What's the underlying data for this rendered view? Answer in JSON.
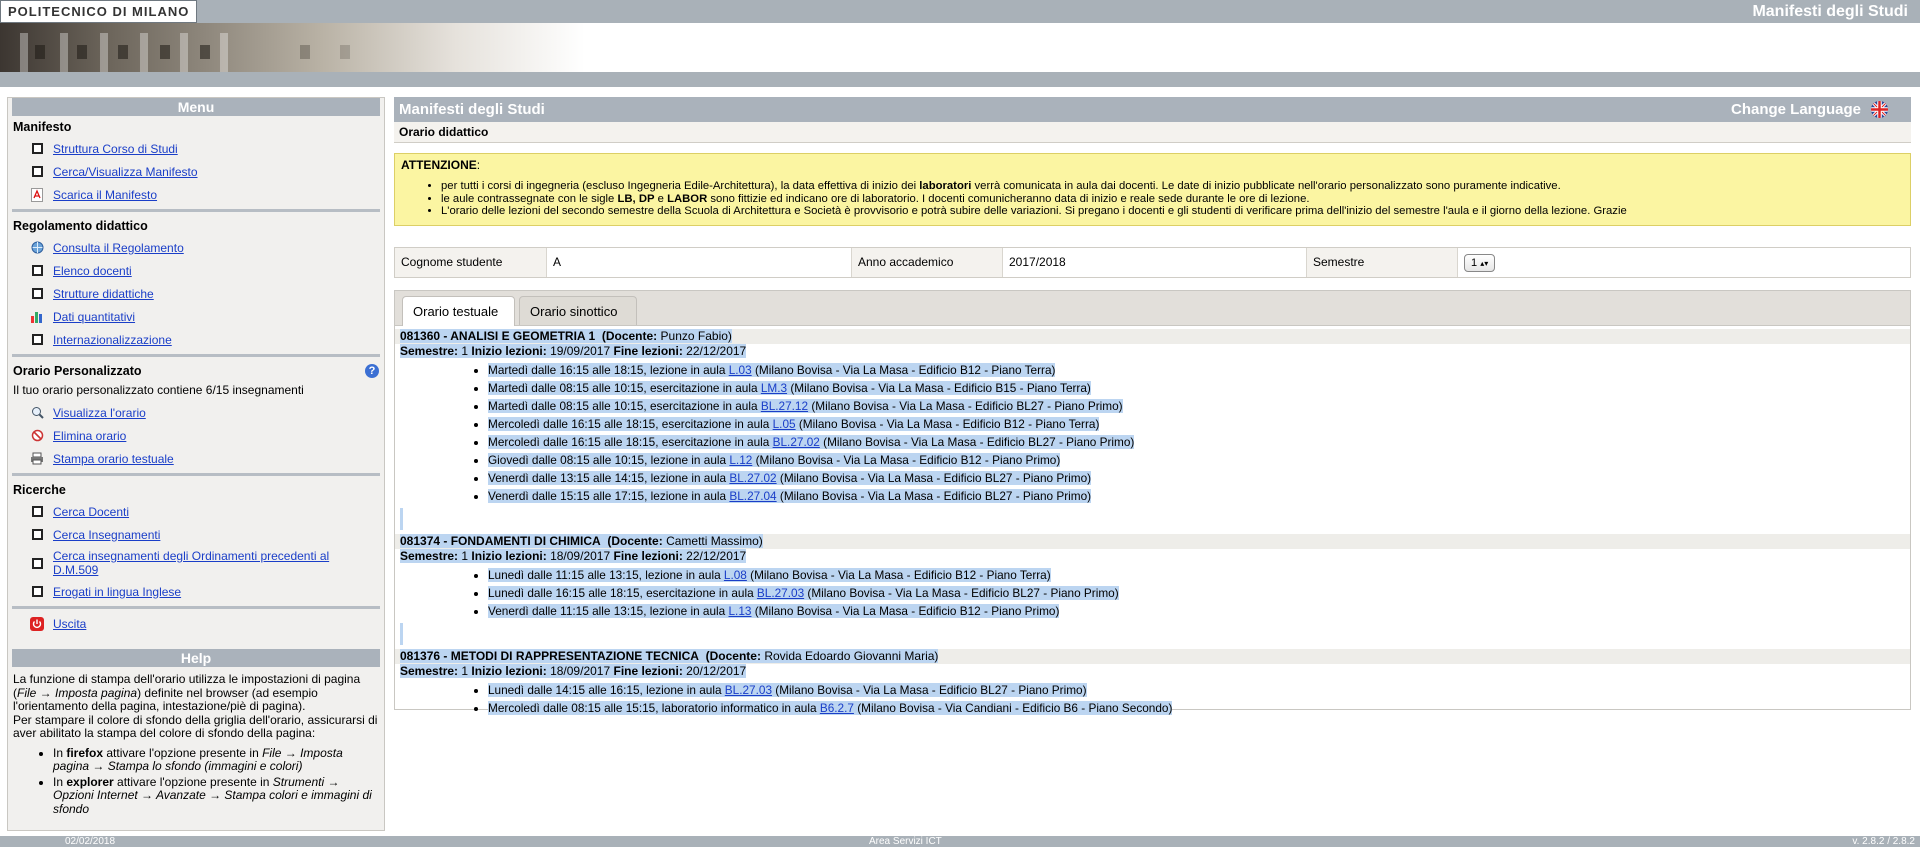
{
  "header": {
    "logo_text": "POLITECNICO DI MILANO",
    "site_title": "Manifesti degli Studi"
  },
  "sidebar": {
    "menu_title": "Menu",
    "sections": {
      "manifesto": {
        "title": "Manifesto",
        "items": [
          "Struttura Corso di Studi",
          "Cerca/Visualizza Manifesto",
          "Scarica il Manifesto"
        ]
      },
      "regolamento": {
        "title": "Regolamento didattico",
        "items": [
          "Consulta il Regolamento",
          "Elenco docenti",
          "Strutture didattiche",
          "Dati quantitativi",
          "Internazionalizzazione"
        ]
      },
      "orario": {
        "title": "Orario Personalizzato",
        "info": "Il tuo orario personalizzato contiene 6/15 insegnamenti",
        "items": [
          "Visualizza l'orario",
          "Elimina orario",
          "Stampa orario testuale"
        ]
      },
      "ricerche": {
        "title": "Ricerche",
        "items": [
          "Cerca Docenti",
          "Cerca Insegnamenti",
          "Cerca insegnamenti degli Ordinamenti precedenti al D.M.509",
          "Erogati in lingua Inglese"
        ]
      },
      "exit_label": "Uscita"
    },
    "help": {
      "title": "Help",
      "p1_a": "La funzione di stampa dell'orario utilizza le impostazioni di pagina (",
      "p1_b": "File → Imposta pagina",
      "p1_c": ") definite nel browser (ad esempio l'orientamento della pagina, intestazione/piè di pagina).",
      "p2": "Per stampare il colore di sfondo della griglia dell'orario, assicurarsi di aver abilitato la stampa del colore di sfondo della pagina:",
      "b1_a": "In ",
      "b1_b": "firefox",
      "b1_c": " attivare l'opzione presente in ",
      "b1_d": "File → Imposta pagina → Stampa lo sfondo (immagini e colori)",
      "b2_a": "In ",
      "b2_b": "explorer",
      "b2_c": " attivare l'opzione presente in ",
      "b2_d": "Strumenti → Opzioni Internet → Avanzate → Stampa colori e immagini di sfondo"
    }
  },
  "main": {
    "title": "Manifesti degli Studi",
    "change_language": "Change Language",
    "subtitle": "Orario didattico",
    "attention": {
      "title": "ATTENZIONE",
      "b1_a": "per tutti i corsi di ingegneria (escluso Ingegneria Edile-Architettura), la data effettiva di inizio dei ",
      "b1_b": "laboratori",
      "b1_c": " verrà comunicata in aula dai docenti. Le date di inizio pubblicate nell'orario personalizzato sono puramente indicative.",
      "b2_a": "le aule contrassegnate con le sigle ",
      "b2_b": "LB, DP",
      "b2_c": " e ",
      "b2_d": "LABOR",
      "b2_e": " sono fittizie ed indicano ore di laboratorio. I docenti comunicheranno data di inizio e reale sede durante le ore di lezione.",
      "b3": "L'orario delle lezioni del secondo semestre della Scuola di Architettura e Società è provvisorio e potrà subire delle variazioni. Si pregano i docenti e gli studenti di verificare prima dell'inizio del semestre l'aula e il giorno della lezione. Grazie"
    },
    "filters": {
      "surname_label": "Cognome studente",
      "surname_value": "A",
      "year_label": "Anno accademico",
      "year_value": "2017/2018",
      "semester_label": "Semestre",
      "semester_value": "1"
    },
    "tabs": [
      "Orario testuale",
      "Orario sinottico"
    ],
    "labels": {
      "docente": "(Docente:",
      "semestre": "Semestre:",
      "inizio": "Inizio lezioni:",
      "fine": "Fine lezioni:"
    },
    "courses": [
      {
        "code_name": "081360 - ANALISI E GEOMETRIA 1",
        "teacher": "Punzo Fabio",
        "semester": "1",
        "start": "19/09/2017",
        "end": "22/12/2017",
        "lessons": [
          {
            "pre": "Martedì dalle 16:15 alle 18:15, lezione in aula ",
            "room": "L.03",
            "post": " (Milano Bovisa - Via La Masa - Edificio B12 - Piano Terra)"
          },
          {
            "pre": "Martedì dalle 08:15 alle 10:15, esercitazione in aula ",
            "room": "LM.3",
            "post": " (Milano Bovisa - Via La Masa - Edificio B15 - Piano Terra)"
          },
          {
            "pre": "Martedì dalle 08:15 alle 10:15, esercitazione in aula ",
            "room": "BL.27.12",
            "post": " (Milano Bovisa - Via La Masa - Edificio BL27 - Piano Primo)"
          },
          {
            "pre": "Mercoledì dalle 16:15 alle 18:15, esercitazione in aula ",
            "room": "L.05",
            "post": " (Milano Bovisa - Via La Masa - Edificio B12 - Piano Terra)"
          },
          {
            "pre": "Mercoledì dalle 16:15 alle 18:15, esercitazione in aula ",
            "room": "BL.27.02",
            "post": " (Milano Bovisa - Via La Masa - Edificio BL27 - Piano Primo)"
          },
          {
            "pre": "Giovedì dalle 08:15 alle 10:15, lezione in aula ",
            "room": "L.12",
            "post": " (Milano Bovisa - Via La Masa - Edificio B12 - Piano Primo)"
          },
          {
            "pre": "Venerdì dalle 13:15 alle 14:15, lezione in aula ",
            "room": "BL.27.02",
            "post": " (Milano Bovisa - Via La Masa - Edificio BL27 - Piano Primo)"
          },
          {
            "pre": "Venerdì dalle 15:15 alle 17:15, lezione in aula ",
            "room": "BL.27.04",
            "post": " (Milano Bovisa - Via La Masa - Edificio BL27 - Piano Primo)"
          }
        ]
      },
      {
        "code_name": "081374 - FONDAMENTI DI CHIMICA",
        "teacher": "Cametti Massimo",
        "semester": "1",
        "start": "18/09/2017",
        "end": "22/12/2017",
        "lessons": [
          {
            "pre": "Lunedì dalle 11:15 alle 13:15, lezione in aula ",
            "room": "L.08",
            "post": " (Milano Bovisa - Via La Masa - Edificio B12 - Piano Terra)"
          },
          {
            "pre": "Lunedì dalle 16:15 alle 18:15, esercitazione in aula ",
            "room": "BL.27.03",
            "post": " (Milano Bovisa - Via La Masa - Edificio BL27 - Piano Primo)"
          },
          {
            "pre": "Venerdì dalle 11:15 alle 13:15, lezione in aula ",
            "room": "L.13",
            "post": " (Milano Bovisa - Via La Masa - Edificio B12 - Piano Primo)"
          }
        ]
      },
      {
        "code_name": "081376 - METODI DI RAPPRESENTAZIONE TECNICA",
        "teacher": "Rovida Edoardo Giovanni Maria",
        "semester": "1",
        "start": "18/09/2017",
        "end": "20/12/2017",
        "lessons": [
          {
            "pre": "Lunedì dalle 14:15 alle 16:15, lezione in aula ",
            "room": "BL.27.03",
            "post": " (Milano Bovisa - Via La Masa - Edificio BL27 - Piano Primo)"
          },
          {
            "pre": "Mercoledì dalle 08:15 alle 15:15, laboratorio informatico in aula ",
            "room": "B6.2.7",
            "post": " (Milano Bovisa - Via Candiani - Edificio B6 - Piano Secondo)"
          }
        ]
      }
    ]
  },
  "footer": {
    "date": "02/02/2018",
    "center": "Area Servizi ICT",
    "version": "v. 2.8.2 / 2.8.2"
  }
}
